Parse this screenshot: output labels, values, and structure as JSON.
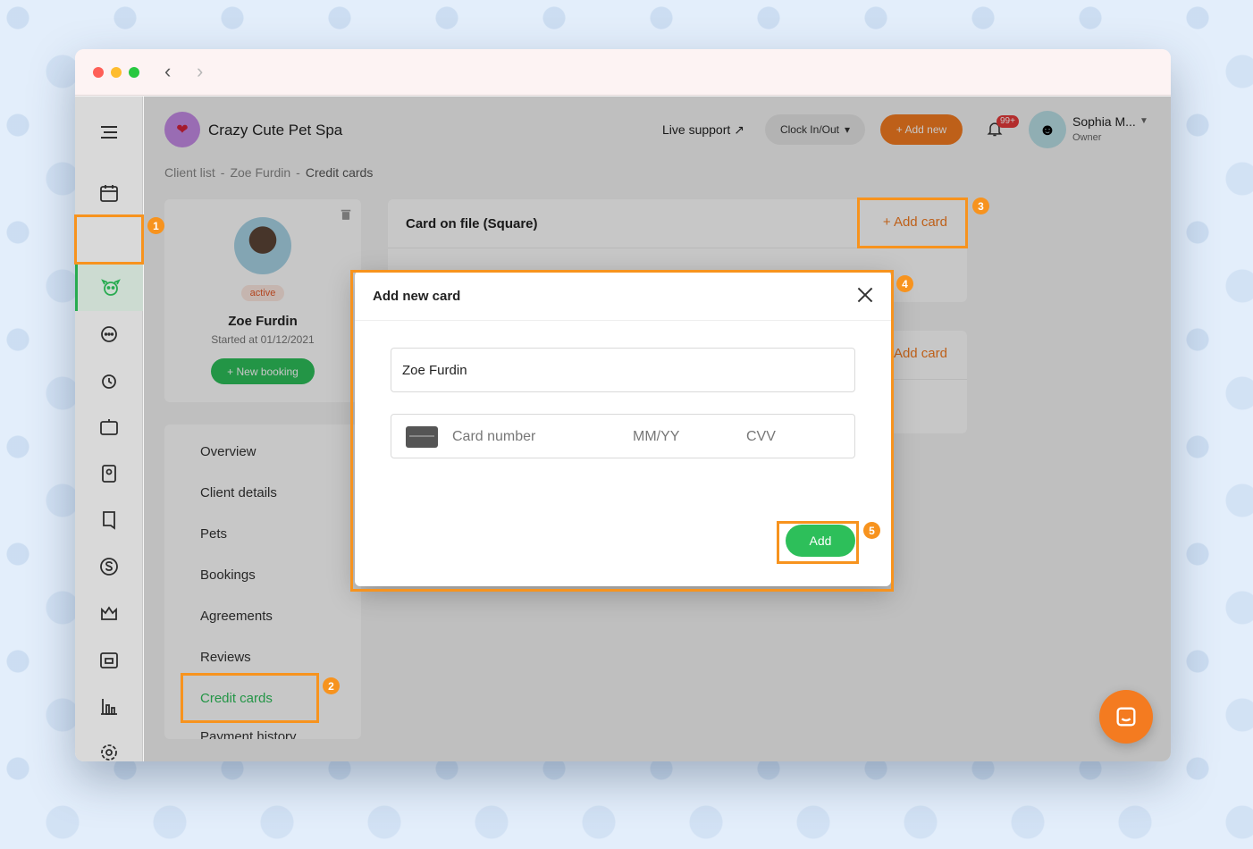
{
  "business": {
    "name": "Crazy Cute Pet Spa"
  },
  "header": {
    "live_support": "Live support",
    "clock_label": "Clock In/Out",
    "add_new_label": "+ Add new",
    "notification_count": "99+",
    "user_name": "Sophia M...",
    "user_role": "Owner"
  },
  "breadcrumb": {
    "items": [
      "Client list",
      "Zoe Furdin",
      "Credit cards"
    ]
  },
  "client": {
    "status": "active",
    "name": "Zoe Furdin",
    "started": "Started at 01/12/2021",
    "new_booking_label": "+ New booking"
  },
  "client_menu": {
    "items": [
      "Overview",
      "Client details",
      "Pets",
      "Bookings",
      "Agreements",
      "Reviews",
      "Credit cards",
      "Payment history"
    ],
    "active": "Credit cards"
  },
  "card_on_file": {
    "title": "Card on file (Square)",
    "add_label": "+ Add card",
    "add_label_2": "Add card"
  },
  "modal": {
    "title": "Add new card",
    "name_value": "Zoe Furdin",
    "card_number_placeholder": "Card number",
    "expiry_placeholder": "MM/YY",
    "cvv_placeholder": "CVV",
    "add_label": "Add"
  },
  "step_markers": [
    "1",
    "2",
    "3",
    "4",
    "5"
  ],
  "colors": {
    "accent": "#f47b20",
    "success": "#2dbf5a",
    "highlight": "#f7931e"
  }
}
